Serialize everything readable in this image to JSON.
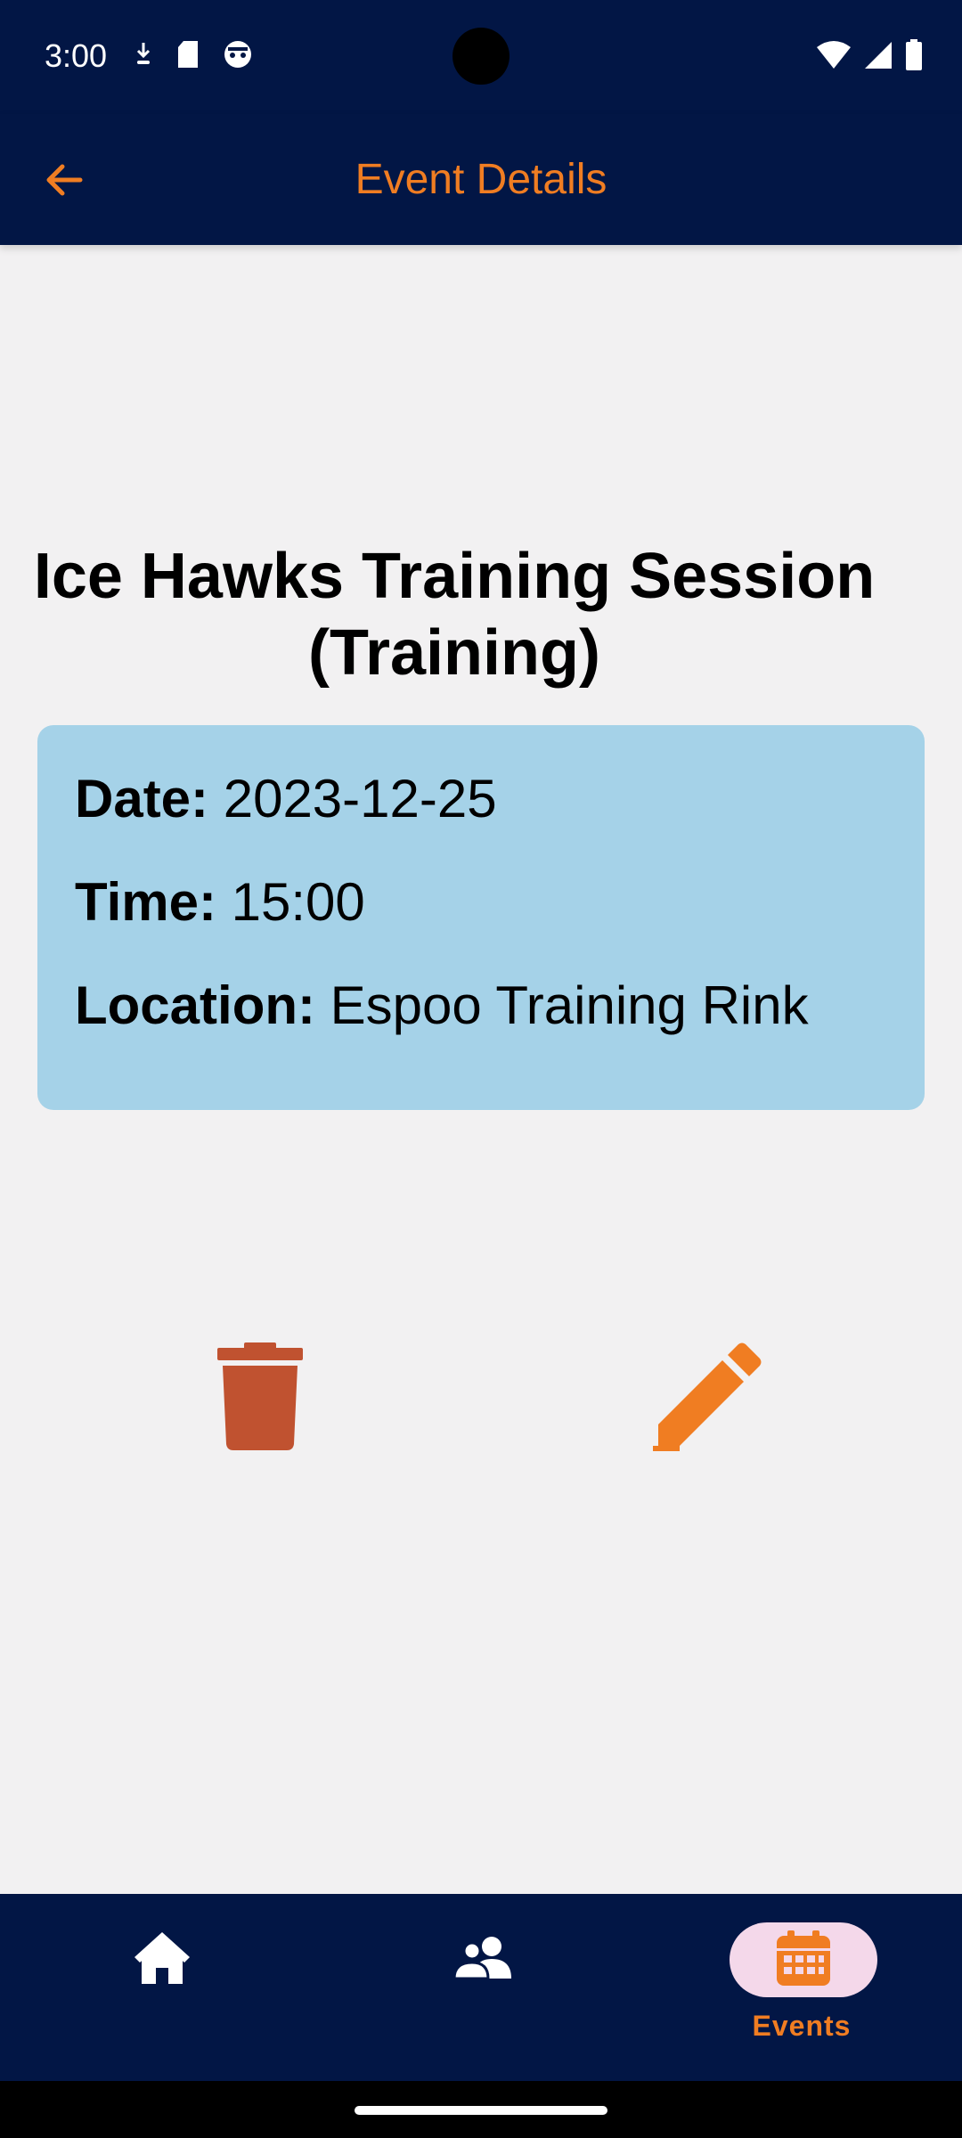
{
  "status_bar": {
    "time": "3:00",
    "left_icons": [
      "download-arrow-icon",
      "sd-card-icon",
      "robot-face-icon"
    ],
    "right_icons": [
      "wifi-icon",
      "cell-signal-icon",
      "battery-icon"
    ]
  },
  "app_bar": {
    "title": "Event Details",
    "back_icon": "arrow-back-icon",
    "background": "#021645",
    "accent": "#f07d22"
  },
  "event": {
    "title_line1": "Ice Hawks Training Session",
    "title_line2": "(Training)",
    "date_label": "Date:",
    "date_value": "2023-12-25",
    "time_label": "Time:",
    "time_value": "15:00",
    "location_label": "Location:",
    "location_value": "Espoo Training Rink",
    "card_color": "#a5d2e8"
  },
  "actions": {
    "delete_icon": "trash-icon",
    "delete_color": "#c05230",
    "edit_icon": "pencil-icon",
    "edit_color": "#f07d22"
  },
  "bottom_nav": {
    "items": [
      {
        "icon": "home-icon",
        "label": "",
        "active": false
      },
      {
        "icon": "users-icon",
        "label": "",
        "active": false
      },
      {
        "icon": "calendar-icon",
        "label": "Events",
        "active": true
      }
    ],
    "active_pill_color": "#f4d8ea"
  }
}
